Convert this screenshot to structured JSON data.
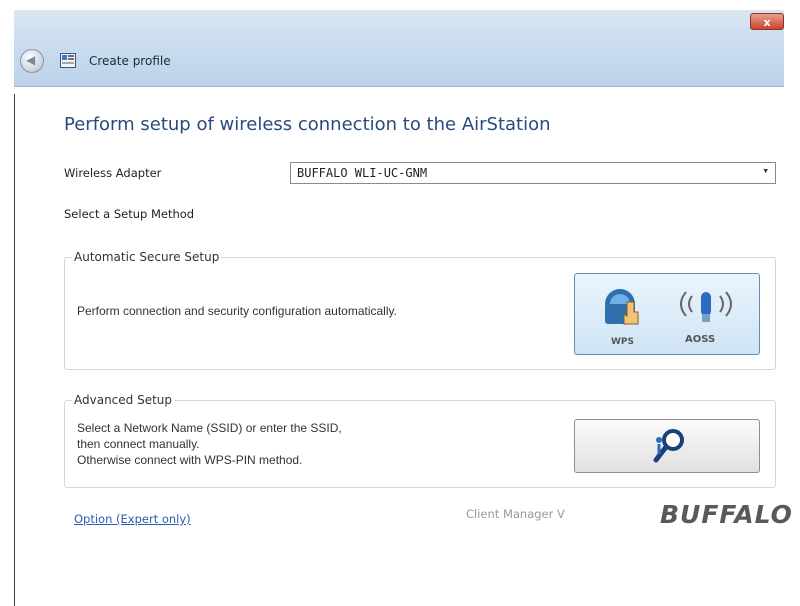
{
  "window": {
    "title": "Create profile",
    "close_label": "x"
  },
  "page": {
    "heading": "Perform setup of wireless connection to the AirStation"
  },
  "adapter": {
    "label": "Wireless Adapter",
    "value": "BUFFALO WLI-UC-GNM"
  },
  "section_label": "Select a Setup Method",
  "automatic": {
    "title": "Automatic Secure Setup",
    "description": "Perform connection and security configuration automatically.",
    "wps_label": "WPS",
    "aoss_label": "AOSS"
  },
  "advanced": {
    "title": "Advanced Setup",
    "line1": "Select a Network Name (SSID) or enter the SSID,",
    "line2": "then connect manually.",
    "line3": "Otherwise connect with WPS-PIN method."
  },
  "footer": {
    "link": "Option (Expert only)",
    "version": "Client Manager V",
    "brand": "BUFFALO"
  }
}
